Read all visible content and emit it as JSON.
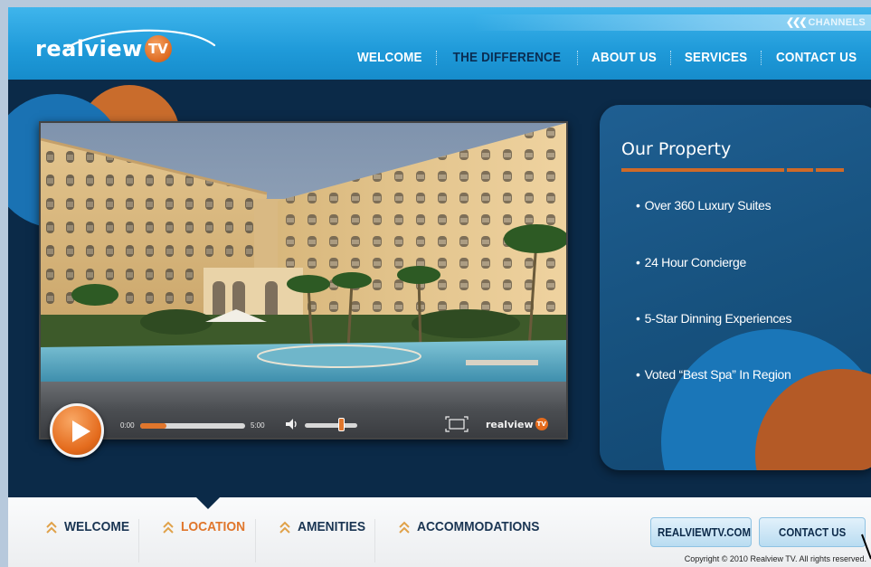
{
  "header": {
    "channels_label": "CHANNELS",
    "logo": {
      "text": "realview",
      "badge": "TV"
    },
    "nav": [
      {
        "label": "WELCOME",
        "active": false
      },
      {
        "label": "THE DIFFERENCE",
        "active": true
      },
      {
        "label": "ABOUT US",
        "active": false
      },
      {
        "label": "SERVICES",
        "active": false
      },
      {
        "label": "CONTACT US",
        "active": false
      }
    ]
  },
  "player": {
    "current_time": "0:00",
    "total_time": "5:00",
    "progress_fraction": 0.25,
    "volume_fraction": 0.7,
    "logo_text": "realview",
    "logo_badge": "TV"
  },
  "property": {
    "title": "Our  Property",
    "items": [
      "Over 360 Luxury Suites",
      "24 Hour Concierge",
      "5-Star Dinning Experiences",
      "Voted “Best Spa” In Region"
    ]
  },
  "subnav": [
    {
      "label": "WELCOME",
      "active": false
    },
    {
      "label": "LOCATION",
      "active": true
    },
    {
      "label": "AMENITIES",
      "active": false
    },
    {
      "label": "ACCOMMODATIONS",
      "active": false
    }
  ],
  "buttons": {
    "site": "REALVIEWTV.COM",
    "contact": "CONTACT US"
  },
  "copyright": "Copyright © 2010 Realview TV.  All rights reserved.",
  "colors": {
    "brand_blue": "#1f9ad9",
    "navy": "#0b2a48",
    "accent_orange": "#e0762c"
  }
}
